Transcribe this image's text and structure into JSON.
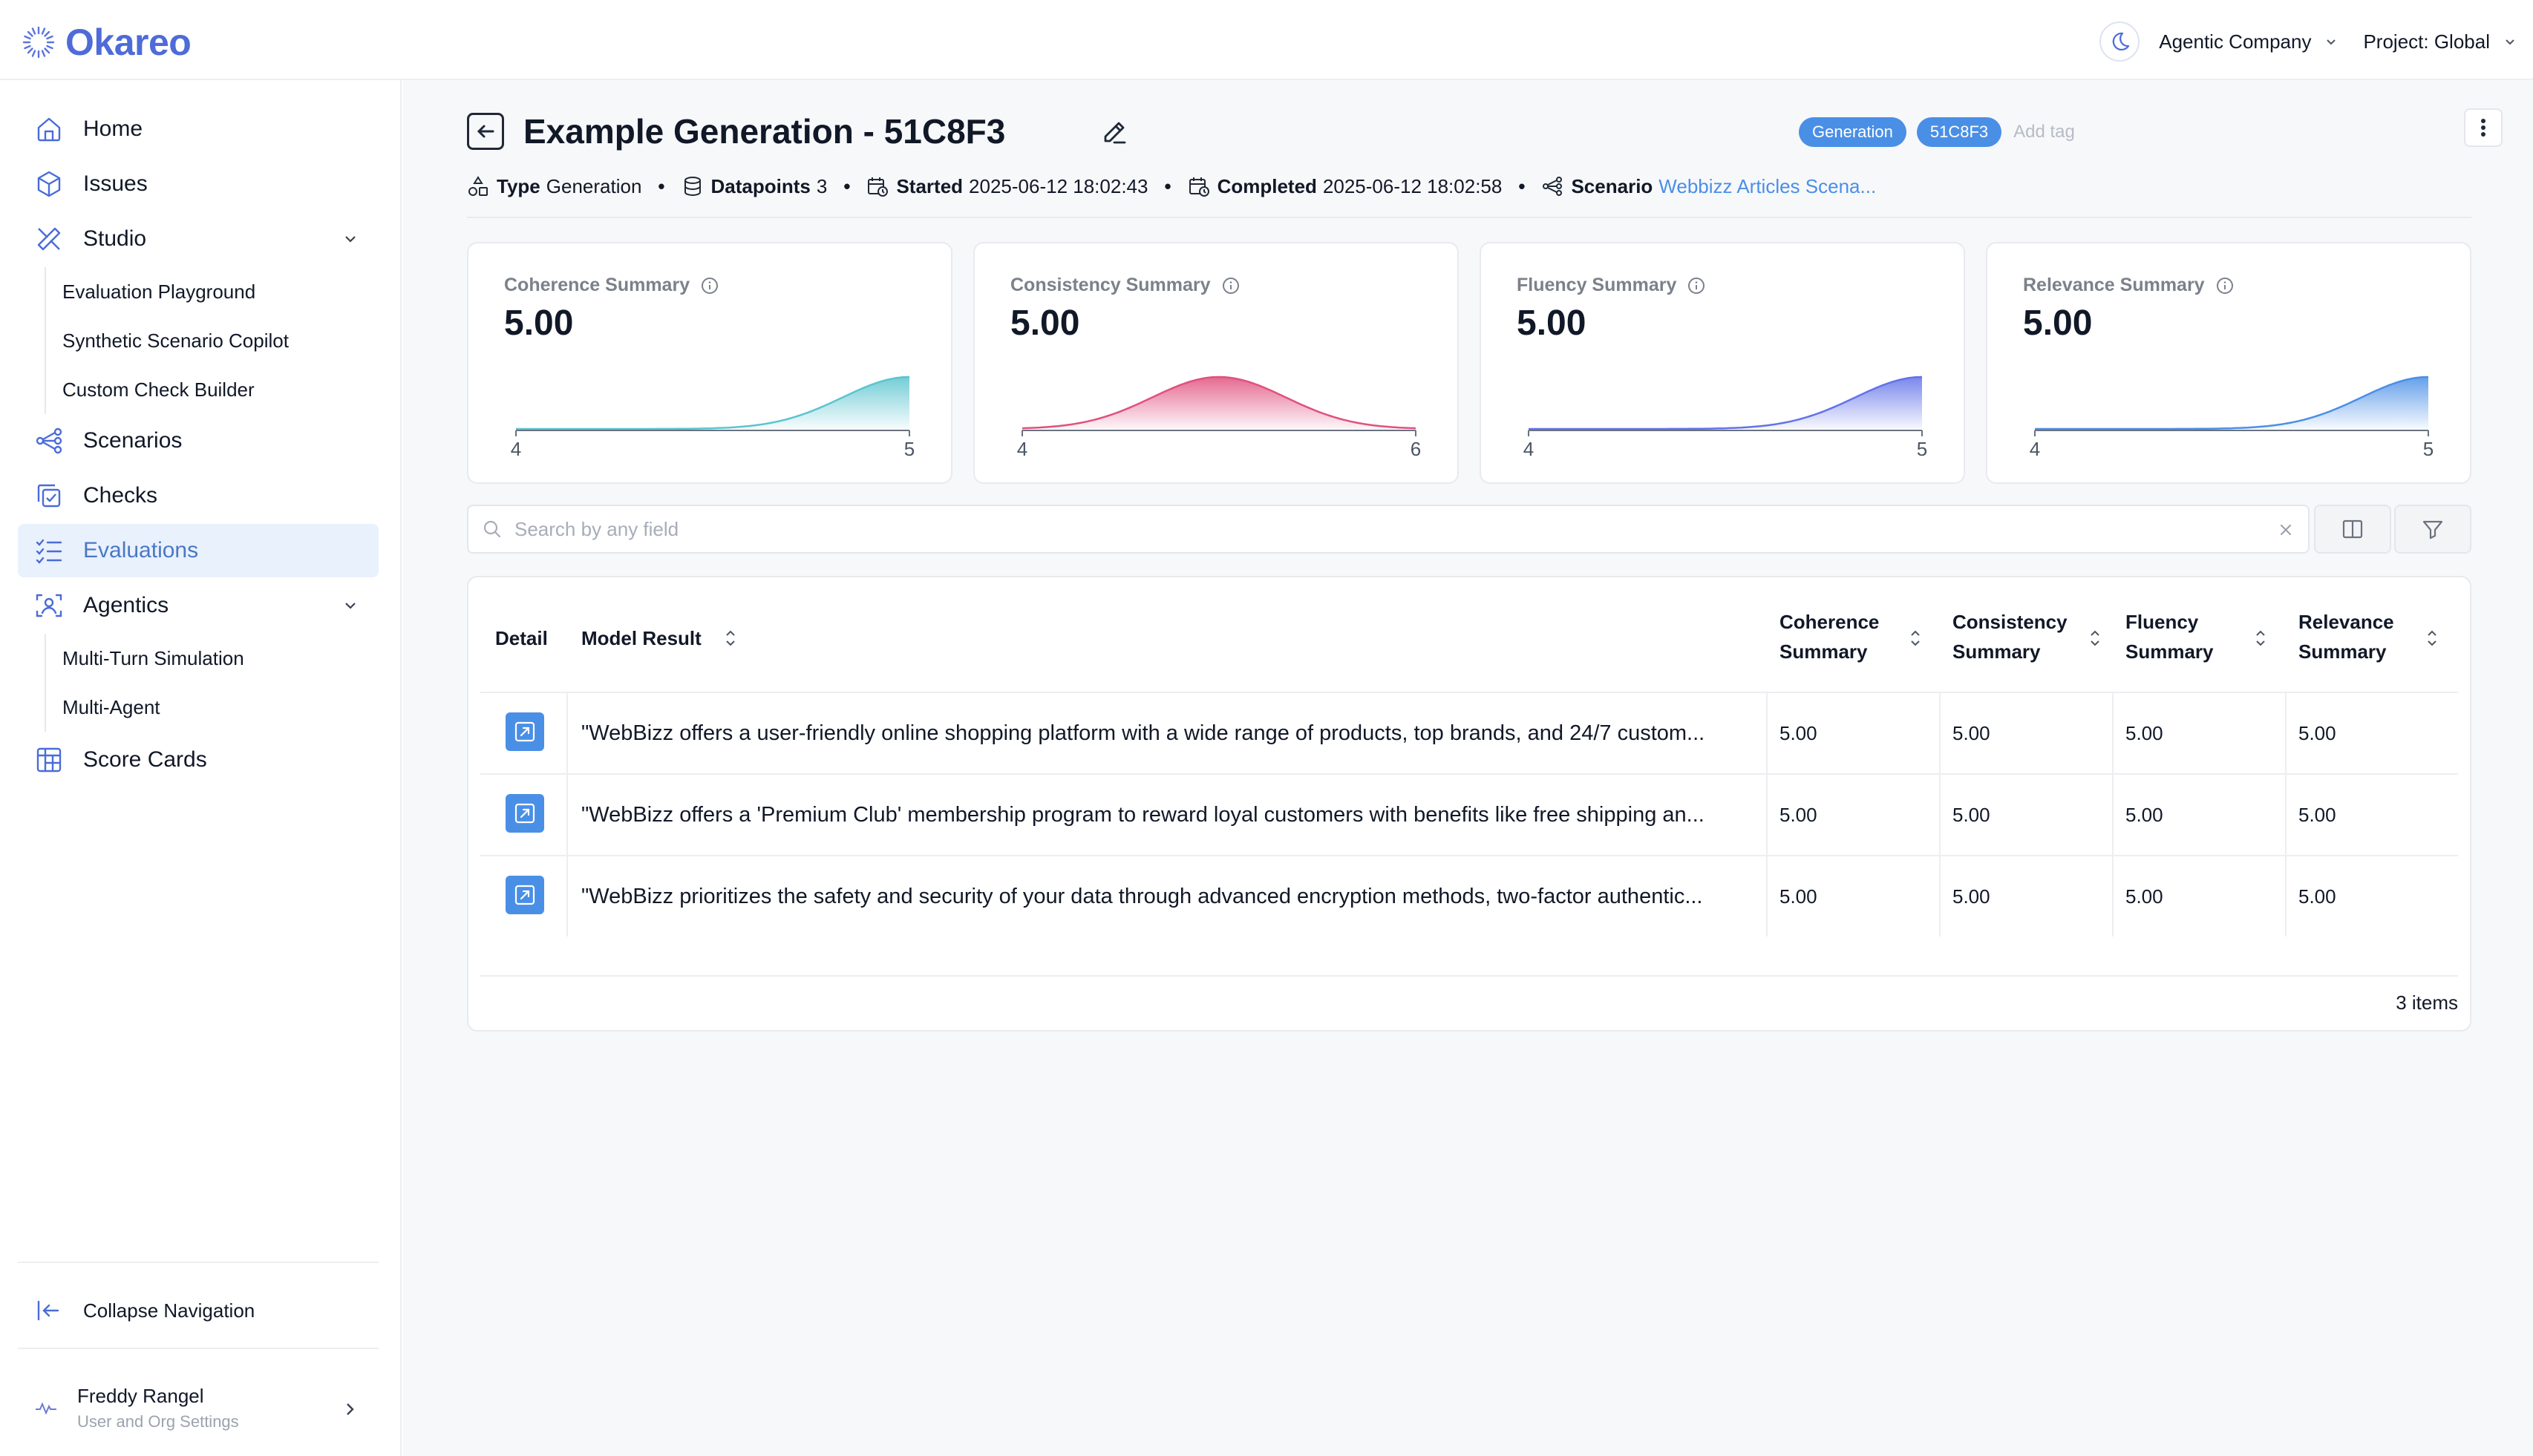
{
  "app": {
    "logo_text": "Okareo"
  },
  "topbar": {
    "org_label": "Agentic Company",
    "project_label": "Project: Global"
  },
  "sidebar": {
    "items": [
      {
        "label": "Home"
      },
      {
        "label": "Issues"
      },
      {
        "label": "Studio",
        "children": [
          "Evaluation Playground",
          "Synthetic Scenario Copilot",
          "Custom Check Builder"
        ]
      },
      {
        "label": "Scenarios"
      },
      {
        "label": "Checks"
      },
      {
        "label": "Evaluations",
        "active": true
      },
      {
        "label": "Agentics",
        "children": [
          "Multi-Turn Simulation",
          "Multi-Agent"
        ]
      },
      {
        "label": "Score Cards"
      }
    ],
    "collapse_label": "Collapse Navigation",
    "user": {
      "name": "Freddy Rangel",
      "subtitle": "User and Org Settings"
    }
  },
  "page": {
    "title": "Example Generation - 51C8F3",
    "tags": [
      "Generation",
      "51C8F3"
    ],
    "add_tag_label": "Add tag",
    "meta": {
      "type_label": "Type",
      "type_value": "Generation",
      "datapoints_label": "Datapoints",
      "datapoints_value": "3",
      "started_label": "Started",
      "started_value": "2025-06-12 18:02:43",
      "completed_label": "Completed",
      "completed_value": "2025-06-12 18:02:58",
      "scenario_label": "Scenario",
      "scenario_value": "Webbizz Articles Scena..."
    }
  },
  "summary_cards": [
    {
      "title": "Coherence Summary",
      "value": "5.00",
      "axis_min": "4",
      "axis_max": "5",
      "color": "#5bc4cf"
    },
    {
      "title": "Consistency Summary",
      "value": "5.00",
      "axis_min": "4",
      "axis_max": "6",
      "color": "#e0507e"
    },
    {
      "title": "Fluency Summary",
      "value": "5.00",
      "axis_min": "4",
      "axis_max": "5",
      "color": "#6272e8"
    },
    {
      "title": "Relevance Summary",
      "value": "5.00",
      "axis_min": "4",
      "axis_max": "5",
      "color": "#4a8fe6"
    }
  ],
  "search": {
    "placeholder": "Search by any field"
  },
  "table": {
    "columns": {
      "detail": "Detail",
      "model_result": "Model Result",
      "coherence": [
        "Coherence",
        "Summary"
      ],
      "consistency": [
        "Consistency",
        "Summary"
      ],
      "fluency": [
        "Fluency",
        "Summary"
      ],
      "relevance": [
        "Relevance",
        "Summary"
      ]
    },
    "rows": [
      {
        "model_result": "\"WebBizz offers a user-friendly online shopping platform with a wide range of products, top brands, and 24/7 custom...",
        "coherence": "5.00",
        "consistency": "5.00",
        "fluency": "5.00",
        "relevance": "5.00"
      },
      {
        "model_result": "\"WebBizz offers a 'Premium Club' membership program to reward loyal customers with benefits like free shipping an...",
        "coherence": "5.00",
        "consistency": "5.00",
        "fluency": "5.00",
        "relevance": "5.00"
      },
      {
        "model_result": "\"WebBizz prioritizes the safety and security of your data through advanced encryption methods, two-factor authentic...",
        "coherence": "5.00",
        "consistency": "5.00",
        "fluency": "5.00",
        "relevance": "5.00"
      }
    ],
    "items_count": "3 items"
  },
  "colors": {
    "accent": "#4a8fe6",
    "brand": "#4f6bd8",
    "active_bg": "#e9f1fd"
  }
}
